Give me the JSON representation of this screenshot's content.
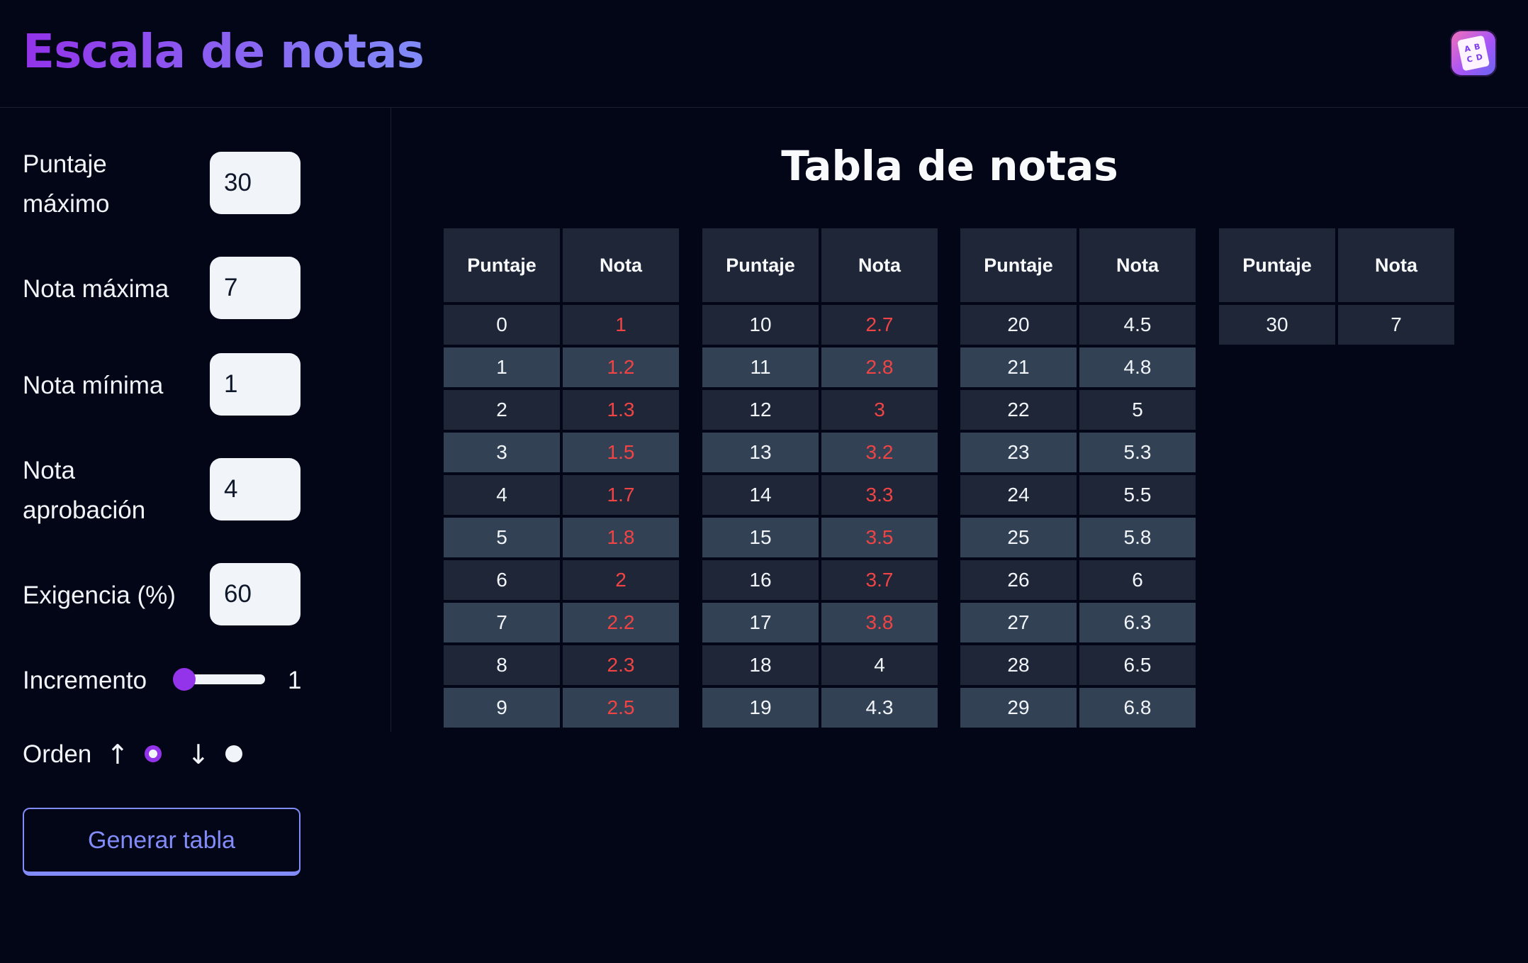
{
  "header": {
    "title": "Escala de notas",
    "logo_icon": "app-logo-icon",
    "logo_letters": [
      "A",
      "B",
      "C",
      "D"
    ]
  },
  "form": {
    "max_score": {
      "label": "Puntaje máximo",
      "value": "30"
    },
    "max_grade": {
      "label": "Nota máxima",
      "value": "7"
    },
    "min_grade": {
      "label": "Nota mínima",
      "value": "1"
    },
    "pass_grade": {
      "label": "Nota aprobación",
      "value": "4"
    },
    "demand": {
      "label": "Exigencia (%)",
      "value": "60"
    },
    "increment": {
      "label": "Incremento",
      "value": "1"
    },
    "order": {
      "label": "Orden",
      "asc_icon": "arrow-up-icon",
      "desc_icon": "arrow-down-icon",
      "selected": "asc"
    },
    "generate_label": "Generar tabla"
  },
  "colors": {
    "accent": "#9333ea",
    "button": "#818cf8",
    "fail": "#f04444",
    "background": "#030617"
  },
  "table": {
    "title": "Tabla de notas",
    "headers": {
      "score": "Puntaje",
      "grade": "Nota"
    },
    "columns": [
      {
        "rows": [
          {
            "score": "0",
            "grade": "1",
            "fail": true
          },
          {
            "score": "1",
            "grade": "1.2",
            "fail": true
          },
          {
            "score": "2",
            "grade": "1.3",
            "fail": true
          },
          {
            "score": "3",
            "grade": "1.5",
            "fail": true
          },
          {
            "score": "4",
            "grade": "1.7",
            "fail": true
          },
          {
            "score": "5",
            "grade": "1.8",
            "fail": true
          },
          {
            "score": "6",
            "grade": "2",
            "fail": true
          },
          {
            "score": "7",
            "grade": "2.2",
            "fail": true
          },
          {
            "score": "8",
            "grade": "2.3",
            "fail": true
          },
          {
            "score": "9",
            "grade": "2.5",
            "fail": true
          }
        ]
      },
      {
        "rows": [
          {
            "score": "10",
            "grade": "2.7",
            "fail": true
          },
          {
            "score": "11",
            "grade": "2.8",
            "fail": true
          },
          {
            "score": "12",
            "grade": "3",
            "fail": true
          },
          {
            "score": "13",
            "grade": "3.2",
            "fail": true
          },
          {
            "score": "14",
            "grade": "3.3",
            "fail": true
          },
          {
            "score": "15",
            "grade": "3.5",
            "fail": true
          },
          {
            "score": "16",
            "grade": "3.7",
            "fail": true
          },
          {
            "score": "17",
            "grade": "3.8",
            "fail": true
          },
          {
            "score": "18",
            "grade": "4",
            "fail": false
          },
          {
            "score": "19",
            "grade": "4.3",
            "fail": false
          }
        ]
      },
      {
        "rows": [
          {
            "score": "20",
            "grade": "4.5",
            "fail": false
          },
          {
            "score": "21",
            "grade": "4.8",
            "fail": false
          },
          {
            "score": "22",
            "grade": "5",
            "fail": false
          },
          {
            "score": "23",
            "grade": "5.3",
            "fail": false
          },
          {
            "score": "24",
            "grade": "5.5",
            "fail": false
          },
          {
            "score": "25",
            "grade": "5.8",
            "fail": false
          },
          {
            "score": "26",
            "grade": "6",
            "fail": false
          },
          {
            "score": "27",
            "grade": "6.3",
            "fail": false
          },
          {
            "score": "28",
            "grade": "6.5",
            "fail": false
          },
          {
            "score": "29",
            "grade": "6.8",
            "fail": false
          }
        ]
      },
      {
        "rows": [
          {
            "score": "30",
            "grade": "7",
            "fail": false
          }
        ]
      }
    ]
  }
}
